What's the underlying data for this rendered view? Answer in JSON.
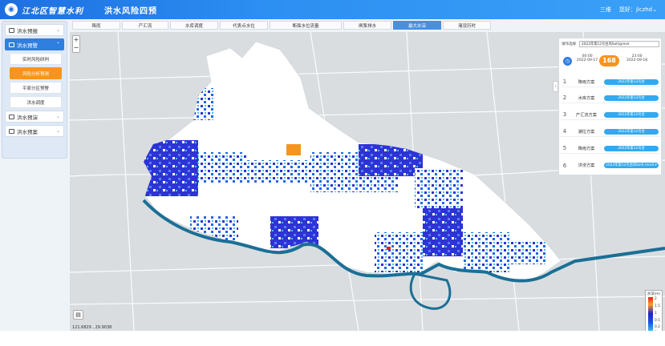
{
  "header": {
    "brand": "江北区智慧水利",
    "module": "洪水风险四预",
    "links": [
      "三维",
      "您好：",
      "jlczhd"
    ]
  },
  "sidebar": {
    "groups": [
      {
        "label": "洪水预报"
      },
      {
        "label": "洪水预警"
      },
      {
        "label": "洪水预演"
      },
      {
        "label": "洪水预案"
      }
    ],
    "sub_items": [
      "实时风险研判",
      "风险分析预测",
      "平原分区预警",
      "洪水调度"
    ]
  },
  "tabs": [
    "降雨",
    "产汇流",
    "水库调度",
    "代表点水位",
    "断面水位流量",
    "闸泵排水",
    "最大水深",
    "淹没历时"
  ],
  "map": {
    "zoom_in": "+",
    "zoom_out": "−",
    "layers_icon": "▤",
    "coords": "121.6829 , 29.9038",
    "place_labels": []
  },
  "panel": {
    "select_label": "请作选择",
    "select_value": "2022年第12号台风Soll(greve",
    "start_time": "00:00",
    "start_date": "2022-09-17",
    "end_time": "23:00",
    "end_date": "2022-09-18",
    "duration": "168",
    "plans": [
      {
        "num": "1",
        "name": "降雨方案",
        "value": "2022年第12号台"
      },
      {
        "num": "2",
        "name": "水库方案",
        "value": "2022年第12号台"
      },
      {
        "num": "3",
        "name": "产汇流方案",
        "value": "2022年第12号台"
      },
      {
        "num": "4",
        "name": "潮位方案",
        "value": "2022年第12号台"
      },
      {
        "num": "5",
        "name": "降雨方案",
        "value": "2022年第12号台"
      },
      {
        "num": "6",
        "name": "洪涝方案",
        "value": "2022年第12号台风Soll(.mord ▾"
      }
    ]
  },
  "legend": {
    "title": "水深(m)",
    "labels": [
      "2",
      "1.5",
      "1",
      "0.5",
      "0.2",
      "0"
    ]
  },
  "colors": {
    "accent": "#2f7fe0",
    "orange": "#f7941d",
    "flood_deep": "#1f2bd0",
    "river": "#1b6f95"
  }
}
